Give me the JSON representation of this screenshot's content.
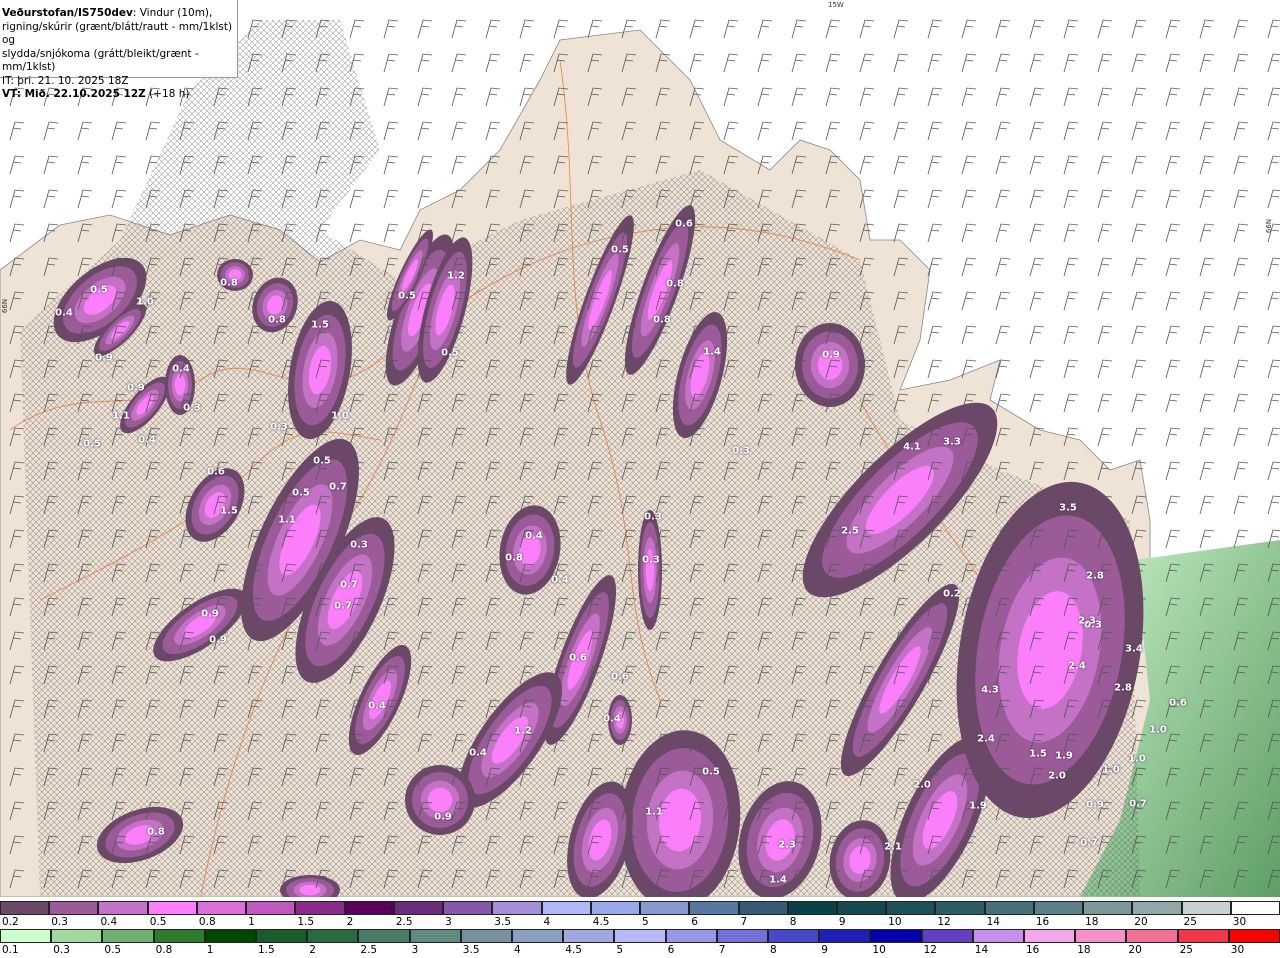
{
  "header": {
    "source": "Veðurstofan/IS750dev",
    "desc_1": ": Vindur (10m),",
    "desc_2": "rigning/skúrir (grænt/blátt/rautt - mm/1klst) og",
    "desc_3": "slydda/snjókoma (grátt/bleikt/grænt - mm/1klst)",
    "it": "IT: þri. 21. 10. 2025 18Z",
    "vt_bold": "VT: Mið. 22.10.2025 12Z",
    "vt_lead": " (+18 h)"
  },
  "map": {
    "gridlabels": {
      "lon": "15W",
      "lat_right": "66N",
      "lat_left": "66N"
    },
    "colors": {
      "sea": "#ffffff",
      "land": "#efe3d6",
      "roads": "#e8743a",
      "barbs": "#555555"
    },
    "value_labels": [
      "0.5",
      "1.0",
      "0.4",
      "0.9",
      "0.9",
      "1.1",
      "0.5",
      "0.4",
      "0.4",
      "0.3",
      "0.8",
      "0.8",
      "1.5",
      "0.3",
      "1.0",
      "0.5",
      "0.7",
      "0.5",
      "0.6",
      "1.5",
      "1.1",
      "0.3",
      "0.7",
      "0.7",
      "0.9",
      "0.9",
      "0.5",
      "1.2",
      "0.5",
      "0.5",
      "0.6",
      "0.8",
      "0.8",
      "0.4",
      "1.4",
      "0.9",
      "0.3",
      "0.3",
      "0.4",
      "0.8",
      "0.3",
      "0.3",
      "4.1",
      "3.3",
      "2.5",
      "0.2",
      "3.5",
      "2.8",
      "2.3",
      "2.4",
      "3.4",
      "2.8",
      "4.3",
      "2.4",
      "1.5",
      "1.9",
      "2.0",
      "1.0",
      "0.9",
      "1.9",
      "0.6",
      "0.6",
      "0.4",
      "0.4",
      "1.2",
      "0.4",
      "0.9",
      "1.1",
      "0.5",
      "2.3",
      "1.4",
      "2.0",
      "2.1",
      "0.8",
      "1.0",
      "0.7",
      "1.0",
      "0.7",
      "0.6"
    ]
  },
  "legend": {
    "snow": {
      "labels": [
        "0.2",
        "0.3",
        "0.4",
        "0.5",
        "0.8",
        "1",
        "1.5",
        "2",
        "2.5",
        "3",
        "3.5",
        "4",
        "4.5",
        "5",
        "6",
        "7",
        "8",
        "9",
        "10",
        "12",
        "14",
        "16",
        "18",
        "20",
        "25",
        "30"
      ],
      "colors": [
        "#6b4868",
        "#9a5b98",
        "#c472c6",
        "#fb7ffb",
        "#dc6edc",
        "#c058c0",
        "#8a2a8a",
        "#5a005a",
        "#6c2c7c",
        "#8858a8",
        "#a590d8",
        "#b0b8f8",
        "#98a8e8",
        "#8898d0",
        "#5878a0",
        "#345a78",
        "#0a4048",
        "#164850",
        "#1e5058",
        "#2c5c64",
        "#467078",
        "#5c8088",
        "#7c9898",
        "#90a8a8",
        "#c8d0d0",
        "#ffffff"
      ]
    },
    "rain": {
      "labels": [
        "0.1",
        "0.3",
        "0.5",
        "0.8",
        "1",
        "1.5",
        "2",
        "2.5",
        "3",
        "3.5",
        "4",
        "4.5",
        "5",
        "6",
        "7",
        "8",
        "9",
        "10",
        "12",
        "14",
        "16",
        "18",
        "20",
        "25",
        "30"
      ],
      "colors": [
        "#ccffcc",
        "#a0d8a0",
        "#70b070",
        "#2e7a2e",
        "#004800",
        "#1a5c2a",
        "#2a6a40",
        "#4a7c68",
        "#5e8a82",
        "#7890a0",
        "#8aa0c0",
        "#a0a8e0",
        "#b8b8f8",
        "#9898e8",
        "#7070d8",
        "#4848c8",
        "#2020b8",
        "#0000a8",
        "#6040c0",
        "#c890e8",
        "#f4a8ec",
        "#f890c8",
        "#f07098",
        "#f03848",
        "#ff0000"
      ]
    }
  }
}
